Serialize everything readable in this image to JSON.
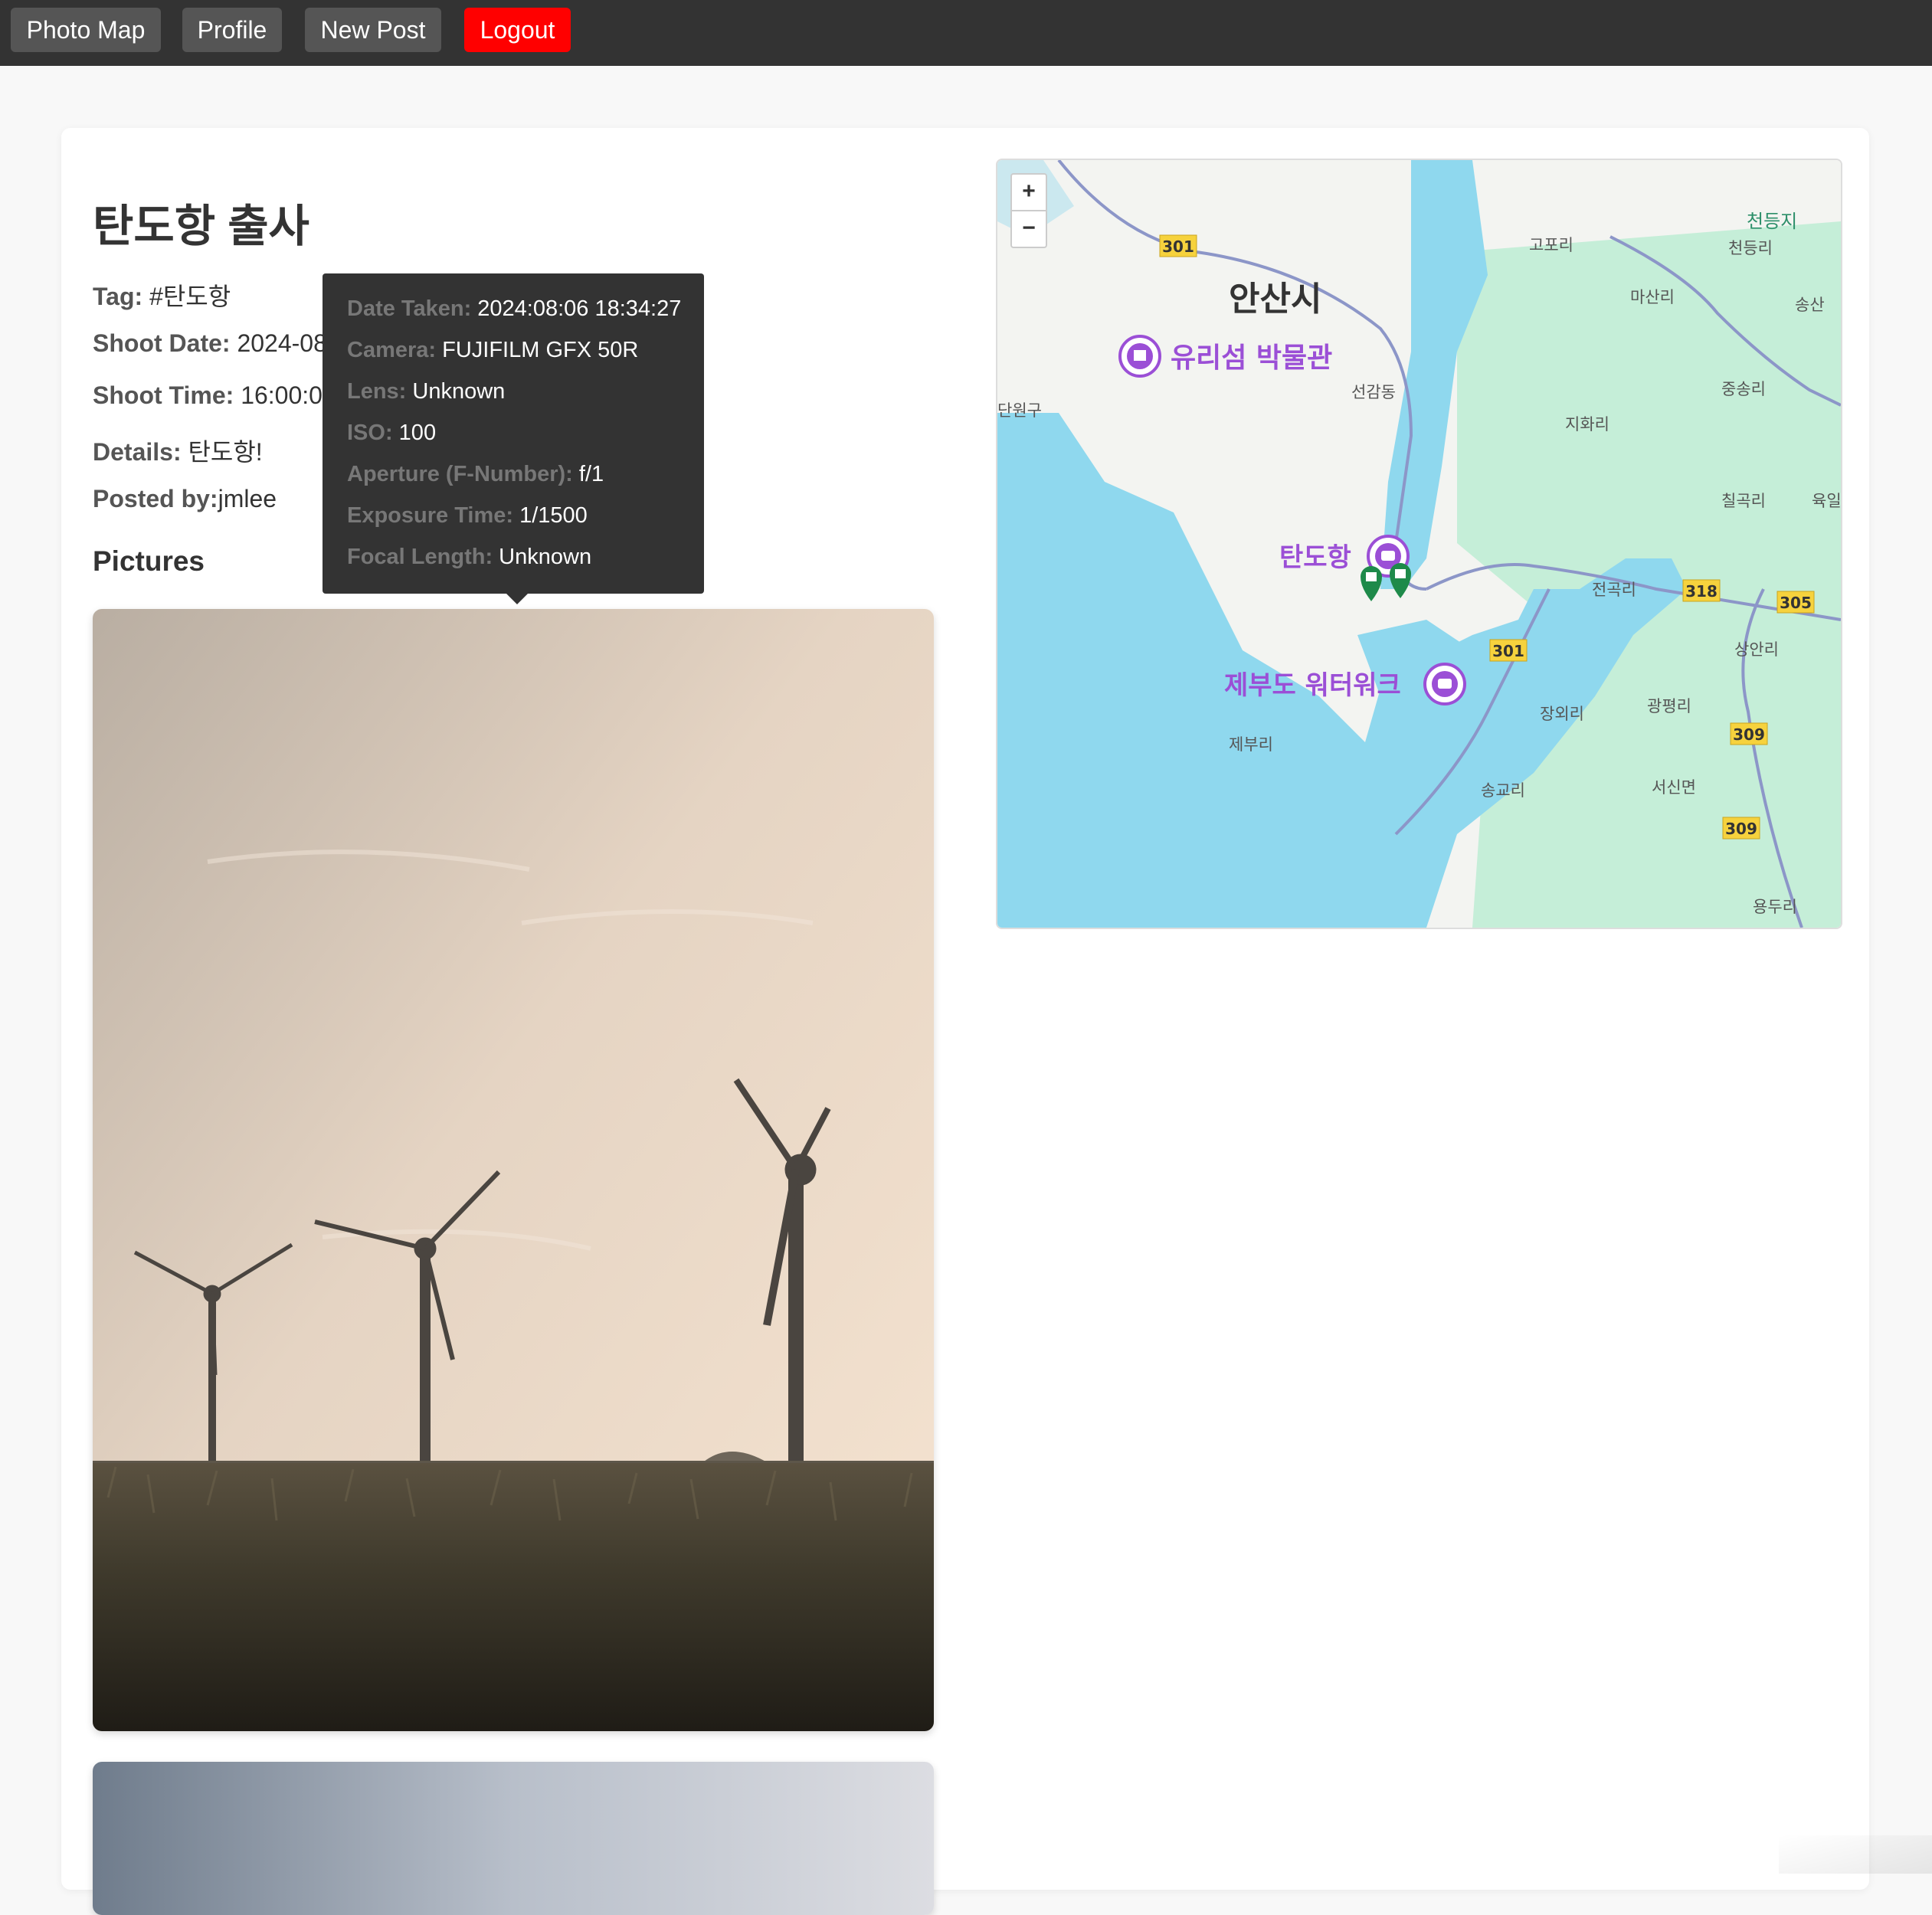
{
  "nav": {
    "photo_map": "Photo Map",
    "profile": "Profile",
    "new_post": "New Post",
    "logout": "Logout"
  },
  "post": {
    "title": "탄도항 출사",
    "tag_label": "Tag:",
    "tag_value": " #탄도항",
    "shoot_date_label": "Shoot Date:",
    "shoot_date_value": " 2024-08-02",
    "shoot_time_label": "Shoot Time:",
    "shoot_time_value": " 16:00:00",
    "details_label": "Details:",
    "details_value": " 탄도항!",
    "posted_by_label": "Posted by:",
    "posted_by_value": "jmlee",
    "pictures_heading": "Pictures"
  },
  "tooltip": {
    "rows": [
      {
        "key": "Date Taken:",
        "value": " 2024:08:06 18:34:27"
      },
      {
        "key": "Camera:",
        "value": " FUJIFILM GFX 50R"
      },
      {
        "key": "Lens:",
        "value": " Unknown"
      },
      {
        "key": "ISO:",
        "value": " 100"
      },
      {
        "key": "Aperture (F-Number):",
        "value": " f/1"
      },
      {
        "key": "Exposure Time:",
        "value": " 1/1500"
      },
      {
        "key": "Focal Length:",
        "value": " Unknown"
      }
    ]
  },
  "map": {
    "zoom_in": "+",
    "zoom_out": "−",
    "city_label": "안산시",
    "poi_1": "유리섬 박물관",
    "poi_2": "탄도항",
    "poi_3": "제부도 워터워크",
    "places": [
      "고포리",
      "천등리",
      "마산리",
      "송산",
      "선감동",
      "단원구",
      "중송리",
      "지화리",
      "칠곡리",
      "육일",
      "전곡리",
      "상안리",
      "장외리",
      "광평리",
      "제부리",
      "송교리",
      "서신면",
      "용두리",
      "천등지"
    ],
    "routes": [
      "301",
      "301",
      "318",
      "305",
      "309",
      "309"
    ],
    "colors": {
      "sea": "#8fd8ee",
      "land": "#f3f4f1",
      "green": "#b9ecd2",
      "poi": "#9b4fd6",
      "marker": "#1e8a4a"
    }
  },
  "colors": {
    "navbar": "#333333",
    "nav_button": "#555555",
    "logout": "#ff0000"
  }
}
